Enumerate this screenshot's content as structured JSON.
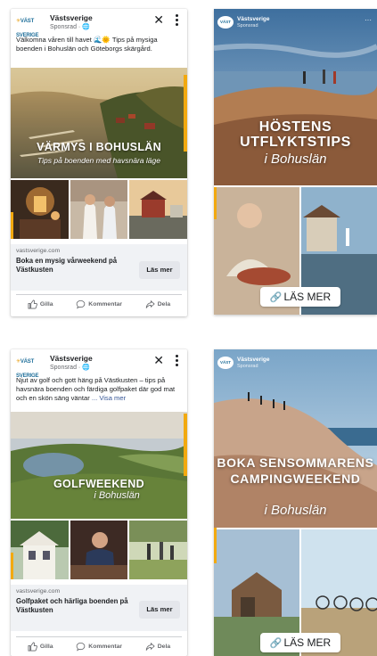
{
  "brand": {
    "name": "Västsverige",
    "sponsored": "Sponsrad",
    "logo_text": "VÄST SVERIGE"
  },
  "fb_ads": [
    {
      "body": "Välkomna våren till havet",
      "body_emoji": "🌊🌞",
      "body_rest": "Tips på mysiga boenden i Bohuslän och Göteborgs skärgård.",
      "hero_title": "VÄRMYS I BOHUSLÄN",
      "hero_sub": "Tips på boenden med havsnära läge",
      "domain": "vastsverige.com",
      "headline": "Boka en mysig vårweekend på Västkusten",
      "cta": "Läs mer"
    },
    {
      "body": "Njut av golf och gott häng på Västkusten – tips på havsnära boenden och färdiga golfpaket där god mat och en skön säng väntar",
      "see_more": "... Visa mer",
      "hero_title": "GOLFWEEKEND",
      "hero_sub": "i Bohuslän",
      "domain": "vastsverige.com",
      "headline": "Golfpaket och härliga boenden på Västkusten",
      "cta": "Läs mer"
    }
  ],
  "actions": {
    "like": "Gilla",
    "comment": "Kommentar",
    "share": "Dela"
  },
  "stories": [
    {
      "title": "HÖSTENS UTFLYKTSTIPS",
      "sub": "i Bohuslän",
      "cta": "LÄS MER"
    },
    {
      "title": "BOKA SENSOMMARENS CAMPINGWEEKEND",
      "sub": "i Bohuslän",
      "cta": "LÄS MER"
    }
  ],
  "colors": {
    "accent": "#f2a90f",
    "fb_gray": "#f0f2f5",
    "link_blue": "#385898"
  }
}
